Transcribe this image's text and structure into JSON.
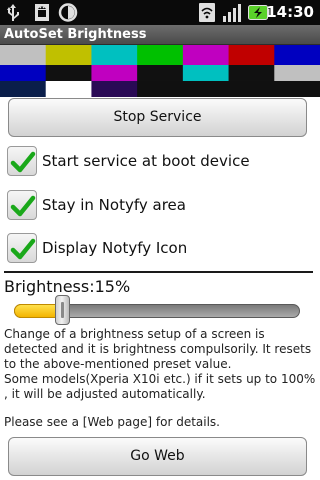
{
  "status_bar": {
    "icons": [
      "usb-icon",
      "android-debug-icon",
      "sync-icon",
      "wifi-icon",
      "signal-icon",
      "battery-charging-icon"
    ],
    "time": "14:30"
  },
  "app": {
    "title": "AutoSet Brightness"
  },
  "color_bars": {
    "rows": [
      [
        "#c0c0c0",
        "#c0c000",
        "#00c0c0",
        "#00c000",
        "#c000c0",
        "#c00000",
        "#0000c0"
      ],
      [
        "#0000c0",
        "#111111",
        "#c000c0",
        "#111111",
        "#00c0c0",
        "#111111",
        "#c0c0c0"
      ],
      [
        "#0a1e4a",
        "#ffffff",
        "#2a0a55",
        "#101010",
        "#101010",
        "#101010",
        "#101010"
      ]
    ]
  },
  "buttons": {
    "stop_service": "Stop Service",
    "go_web": "Go Web"
  },
  "options": [
    {
      "label": "Start service at boot device",
      "checked": true
    },
    {
      "label": "Stay in Notyfy area",
      "checked": true
    },
    {
      "label": "Display Notyfy Icon",
      "checked": true
    }
  ],
  "brightness": {
    "label": "Brightness:15%",
    "value_percent": 15
  },
  "description": "Change of a brightness setup of a screen is detected and it is brightness compulsorily. It resets to the above-mentioned preset value.\nSome models(Xperia X10i etc.) if it sets up to 100% , it will be adjusted automatically.",
  "note": "Please see a [Web page] for details.",
  "colors": {
    "accent_yellow": "#f4b400",
    "check_green": "#1aa81a",
    "status_bar": "#0a0a0a",
    "battery_green": "#5ad12a"
  }
}
